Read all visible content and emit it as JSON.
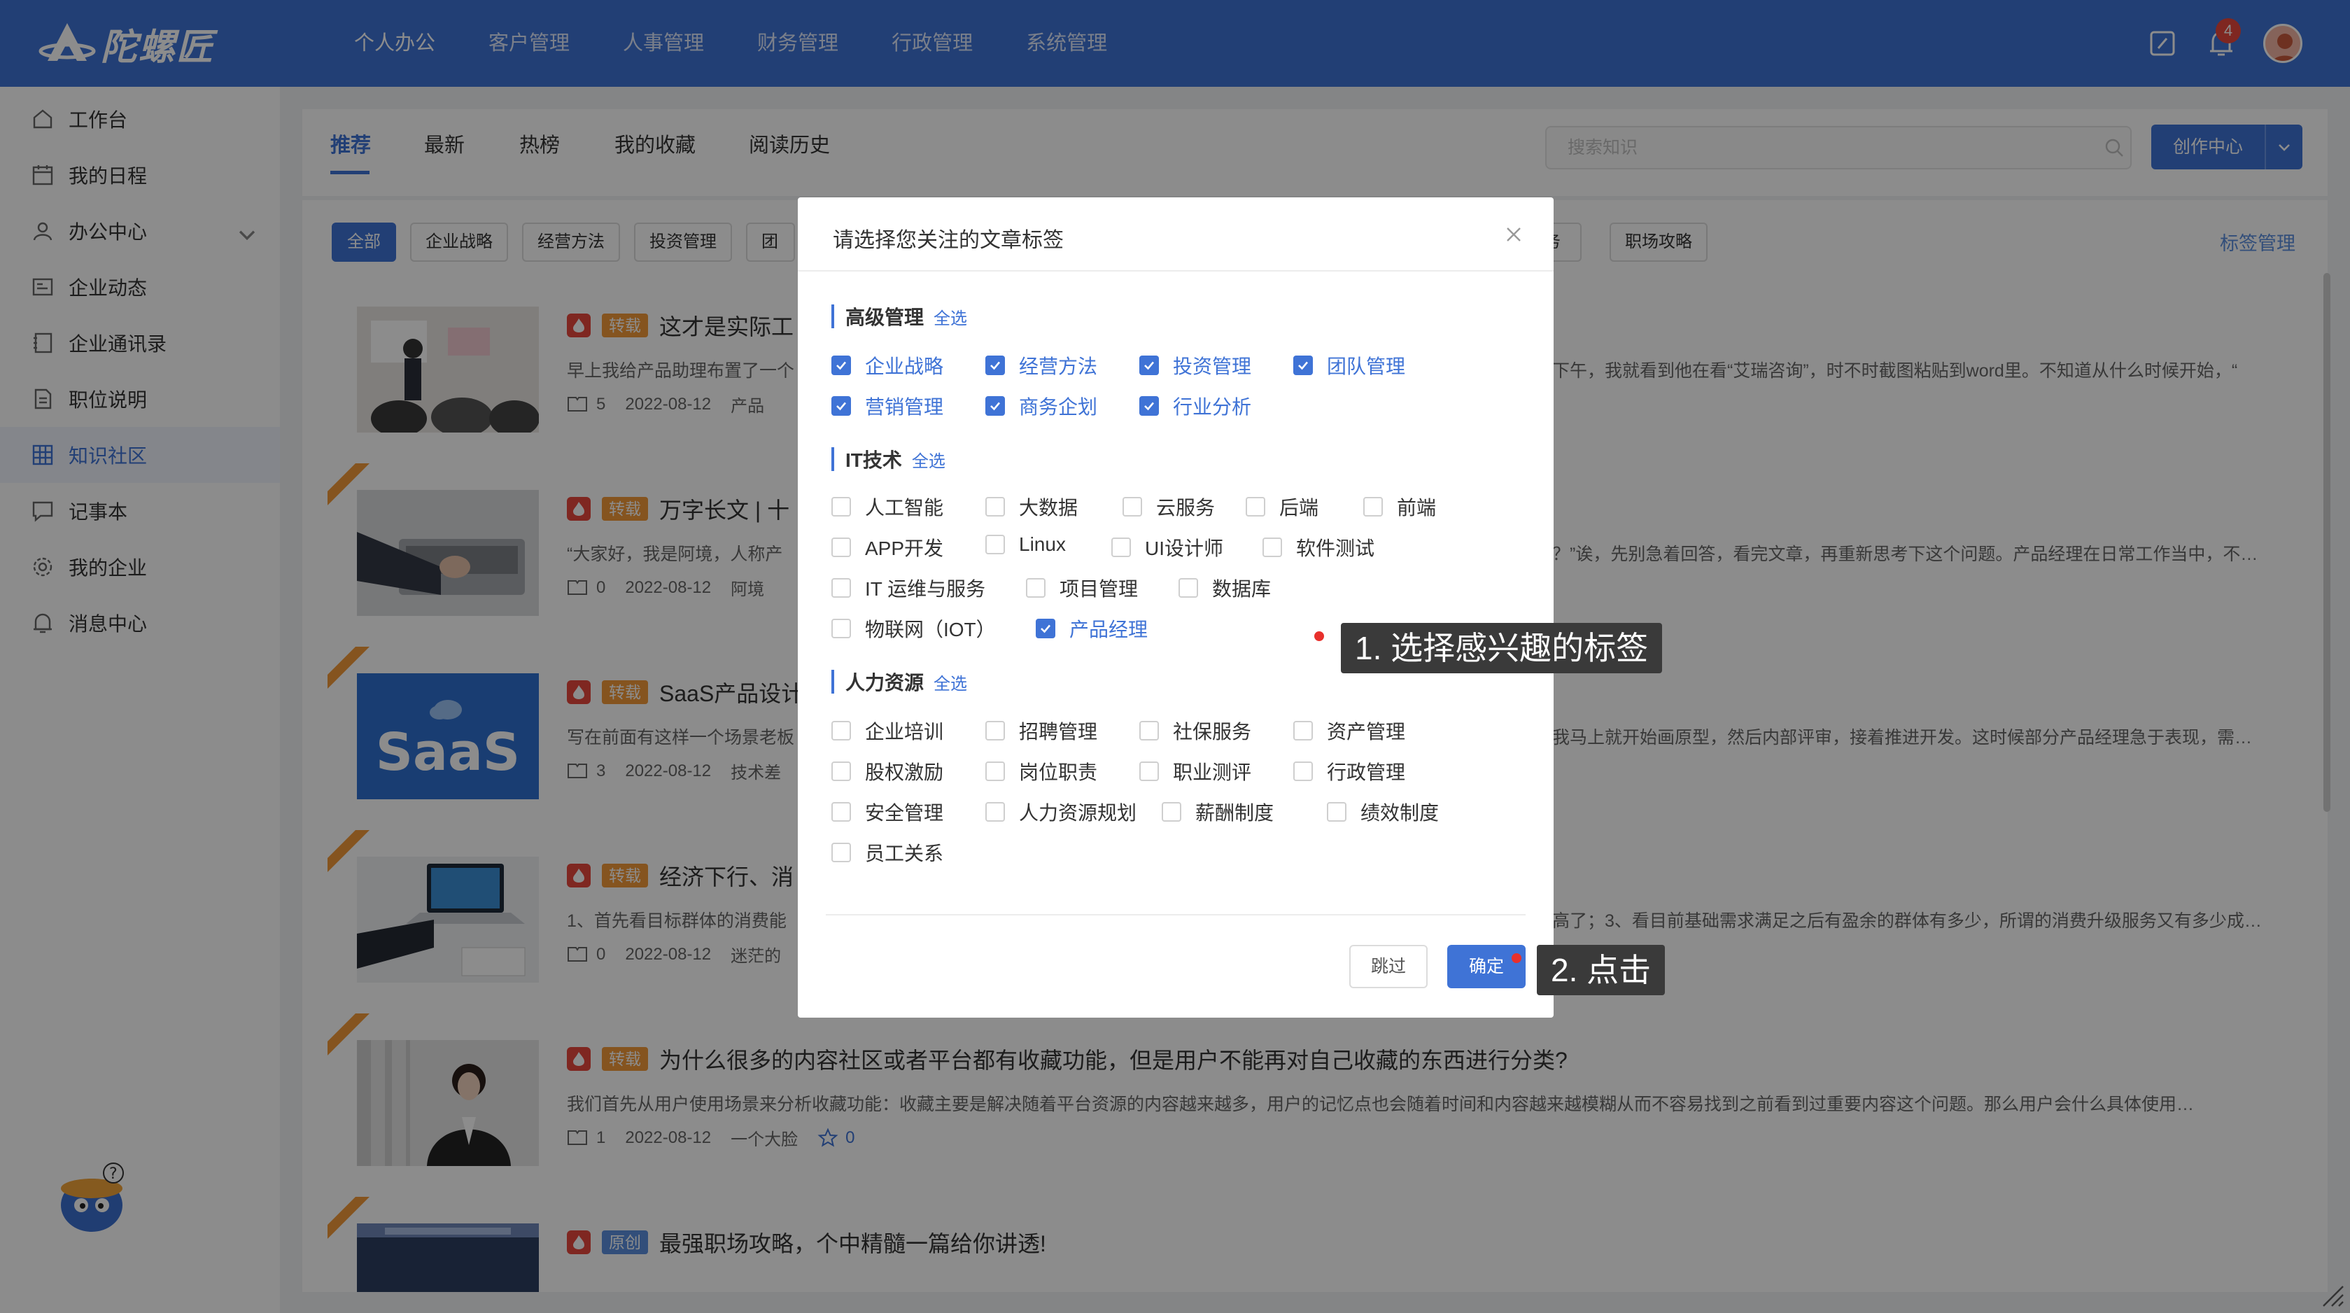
{
  "app": {
    "logo_text": "陀螺匠",
    "notification_count": "4"
  },
  "topnav": [
    "个人办公",
    "客户管理",
    "人事管理",
    "财务管理",
    "行政管理",
    "系统管理"
  ],
  "sidebar": {
    "items": [
      "工作台",
      "我的日程",
      "办公中心",
      "企业动态",
      "企业通讯录",
      "职位说明",
      "知识社区",
      "记事本",
      "我的企业",
      "消息中心"
    ]
  },
  "tabs": [
    "推荐",
    "最新",
    "热榜",
    "我的收藏",
    "阅读历史"
  ],
  "search": {
    "placeholder": "搜索知识"
  },
  "create_button": "创作中心",
  "chips": [
    "全部",
    "企业战略",
    "经营方法",
    "投资管理",
    "团队",
    "务",
    "职场攻略"
  ],
  "tag_manage": "标签管理",
  "articles": [
    {
      "kind": "转载",
      "title": "这才是实际工",
      "summary": "早上我给产品助理布置了一个",
      "summary_right": "下午，我就看到他在看“艾瑞咨询”，时不时截图粘贴到word里。不知道从什么时候开始，“",
      "count": "5",
      "date": "2022-08-12",
      "author": "产品"
    },
    {
      "kind": "转载",
      "title": "万字长文 | 十",
      "summary": "“大家好，我是阿境，人称产",
      "summary_right": "？”诶，先别急着回答，看完文章，再重新思考下这个问题。产品经理在日常工作当中，不…",
      "count": "0",
      "date": "2022-08-12",
      "author": "阿境"
    },
    {
      "kind": "转载",
      "title": "SaaS产品设计",
      "summary": "写在前面有这样一个场景老板",
      "summary_right": "我马上就开始画原型，然后内部评审，接着推进开发。这时候部分产品经理急于表现，需…",
      "count": "3",
      "date": "2022-08-12",
      "author": "技术差",
      "thumb_text": "SaaS"
    },
    {
      "kind": "转载",
      "title": "经济下行、消",
      "summary": "1、首先看目标群体的消费能",
      "summary_right": "高了；3、看目前基础需求满足之后有盈余的群体有多少，所谓的消费升级服务又有多少成…",
      "count": "0",
      "date": "2022-08-12",
      "author": "迷茫的"
    },
    {
      "kind": "转载",
      "title": "为什么很多的内容社区或者平台都有收藏功能，但是用户不能再对自己收藏的东西进行分类?",
      "summary": "我们首先从用户使用场景来分析收藏功能：收藏主要是解决随着平台资源的内容越来越多，用户的记忆点也会随着时间和内容越来越模糊从而不容易找到之前看到过重要内容这个问题。那么用户会什么具体使用…",
      "count": "1",
      "date": "2022-08-12",
      "author": "一个大脸",
      "stars": "0"
    },
    {
      "kind": "原创",
      "title": "最强职场攻略，个中精髓一篇给你讲透!"
    }
  ],
  "modal": {
    "title": "请选择您关注的文章标签",
    "sections": [
      {
        "name": "高级管理",
        "select_all": "全选",
        "tags": [
          {
            "label": "企业战略",
            "checked": true
          },
          {
            "label": "经营方法",
            "checked": true
          },
          {
            "label": "投资管理",
            "checked": true
          },
          {
            "label": "团队管理",
            "checked": true
          },
          {
            "label": "营销管理",
            "checked": true
          },
          {
            "label": "商务企划",
            "checked": true
          },
          {
            "label": "行业分析",
            "checked": true
          }
        ]
      },
      {
        "name": "IT技术",
        "select_all": "全选",
        "tags": [
          {
            "label": "人工智能",
            "checked": false
          },
          {
            "label": "大数据",
            "checked": false
          },
          {
            "label": "云服务",
            "checked": false
          },
          {
            "label": "后端",
            "checked": false
          },
          {
            "label": "前端",
            "checked": false
          },
          {
            "label": "APP开发",
            "checked": false
          },
          {
            "label": "Linux",
            "checked": false
          },
          {
            "label": "UI设计师",
            "checked": false
          },
          {
            "label": "软件测试",
            "checked": false
          },
          {
            "label": "IT 运维与服务",
            "checked": false
          },
          {
            "label": "项目管理",
            "checked": false
          },
          {
            "label": "数据库",
            "checked": false
          },
          {
            "label": "物联网（IOT）",
            "checked": false
          },
          {
            "label": "产品经理",
            "checked": true
          }
        ]
      },
      {
        "name": "人力资源",
        "select_all": "全选",
        "tags": [
          {
            "label": "企业培训",
            "checked": false
          },
          {
            "label": "招聘管理",
            "checked": false
          },
          {
            "label": "社保服务",
            "checked": false
          },
          {
            "label": "资产管理",
            "checked": false
          },
          {
            "label": "股权激励",
            "checked": false
          },
          {
            "label": "岗位职责",
            "checked": false
          },
          {
            "label": "职业测评",
            "checked": false
          },
          {
            "label": "行政管理",
            "checked": false
          },
          {
            "label": "安全管理",
            "checked": false
          },
          {
            "label": "人力资源规划",
            "checked": false
          },
          {
            "label": "薪酬制度",
            "checked": false
          },
          {
            "label": "绩效制度",
            "checked": false
          },
          {
            "label": "员工关系",
            "checked": false
          }
        ]
      }
    ],
    "skip_label": "跳过",
    "ok_label": "确定"
  },
  "callouts": {
    "step1": "1. 选择感兴趣的标签",
    "step2": "2. 点击"
  },
  "colors": {
    "brand": "#3f73d6",
    "hot": "#e8483c",
    "repost": "#f29a3a",
    "original": "#5b8ede"
  }
}
